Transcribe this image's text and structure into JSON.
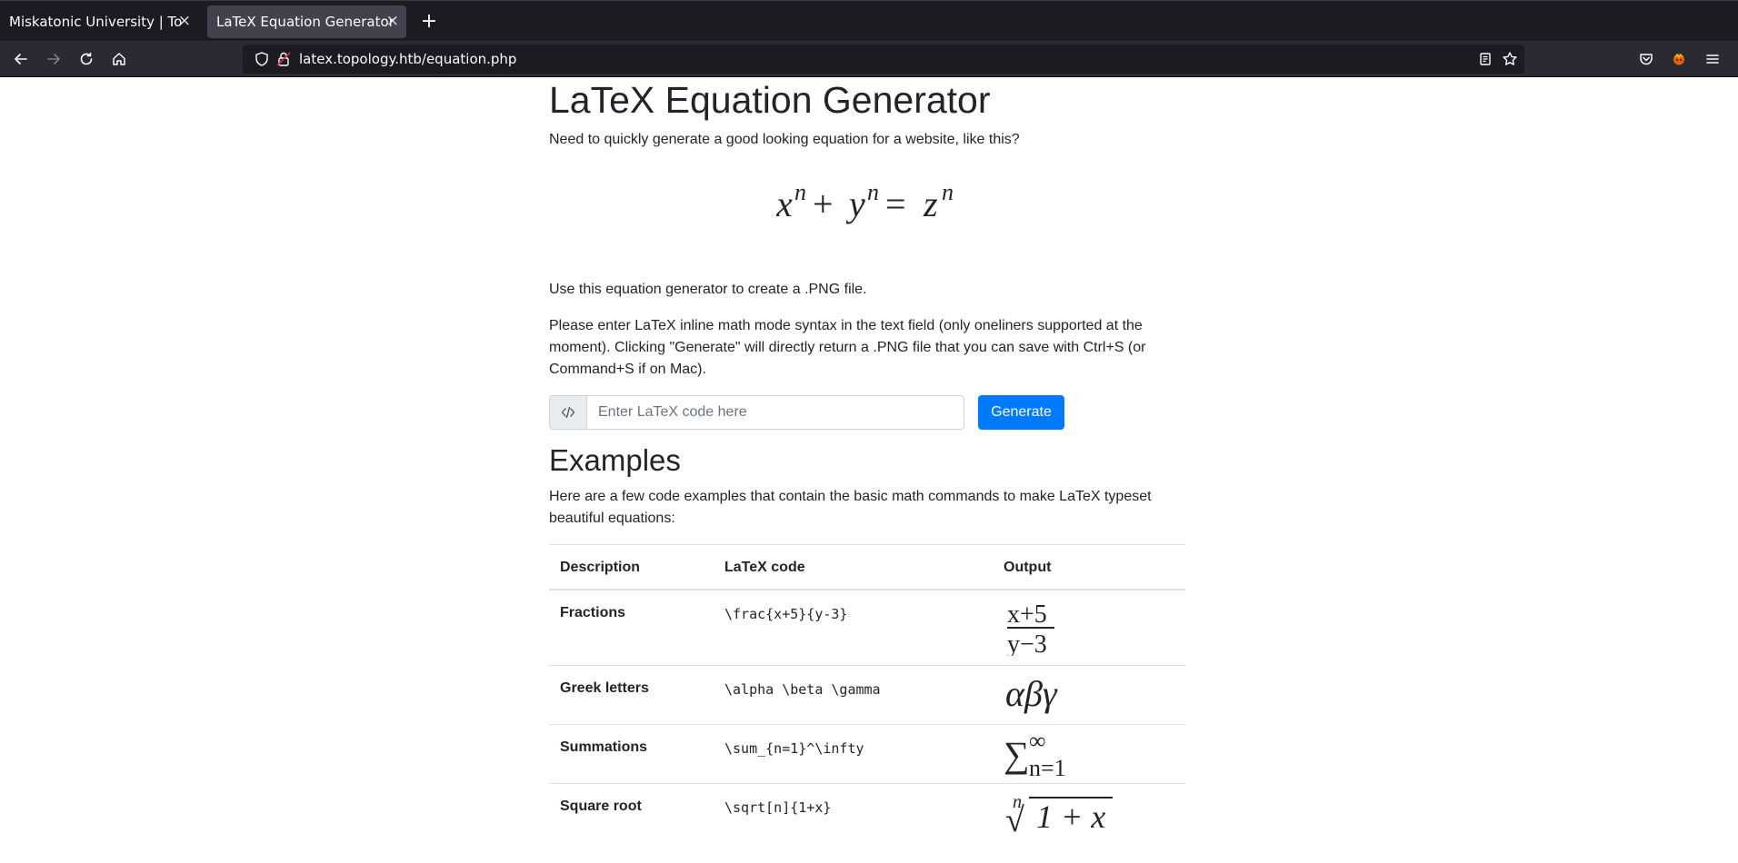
{
  "browser": {
    "tabs": [
      {
        "title": "Miskatonic University | Topology Group",
        "active": false
      },
      {
        "title": "LaTeX Equation Generator",
        "active": true
      }
    ],
    "url": "latex.topology.htb/equation.php"
  },
  "page": {
    "title": "LaTeX Equation Generator",
    "intro": "Need to quickly generate a good looking equation for a website, like this?",
    "hero_equation": {
      "x": "x",
      "y": "y",
      "z": "z",
      "exp": "n",
      "plus": "+",
      "eq": "="
    },
    "usage": "Use this equation generator to create a .PNG file.",
    "instructions": "Please enter LaTeX inline math mode syntax in the text field (only oneliners supported at the moment). Clicking \"Generate\" will directly return a .PNG file that you can save with Ctrl+S (or Command+S if on Mac).",
    "input_placeholder": "Enter LaTeX code here",
    "input_value": "",
    "generate_label": "Generate",
    "examples_title": "Examples",
    "examples_intro": "Here are a few code examples that contain the basic math commands to make LaTeX typeset beautiful equations:"
  },
  "table": {
    "headers": [
      "Description",
      "LaTeX code",
      "Output"
    ],
    "rows": [
      {
        "description": "Fractions",
        "code": "\\frac{x+5}{y-3}",
        "output": {
          "numerator": "x+5",
          "denominator": "y−3"
        }
      },
      {
        "description": "Greek letters",
        "code": "\\alpha \\beta \\gamma",
        "output": {
          "text": "αβγ"
        }
      },
      {
        "description": "Summations",
        "code": "\\sum_{n=1}^\\infty",
        "output": {
          "symbol": "∑",
          "sup": "∞",
          "sub": "n=1"
        }
      },
      {
        "description": "Square root",
        "code": "\\sqrt[n]{1+x}",
        "output": {
          "index": "n",
          "radicand": "1 + x",
          "radical": "√"
        }
      }
    ]
  },
  "colors": {
    "primary": "#007bff",
    "chrome_dark": "#1c1b22",
    "chrome_mid": "#2b2a33",
    "text": "#212529"
  }
}
